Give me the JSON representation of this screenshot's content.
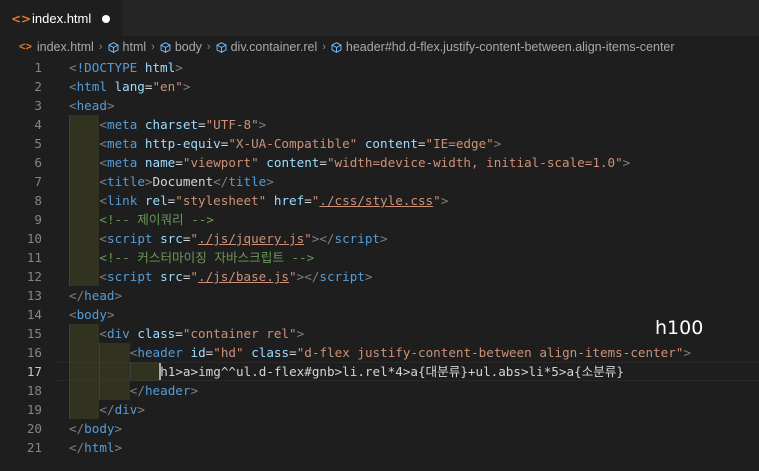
{
  "tab": {
    "icon": "html-code-icon",
    "label": "index.html",
    "dirty": true
  },
  "breadcrumb": [
    {
      "label": "index.html",
      "icon": "html-code-icon"
    },
    {
      "label": "html",
      "icon": "symbol-cube-icon"
    },
    {
      "label": "body",
      "icon": "symbol-cube-icon"
    },
    {
      "label": "div.container.rel",
      "icon": "symbol-cube-icon"
    },
    {
      "label": "header#hd.d-flex.justify-content-between.align-items-center",
      "icon": "symbol-cube-icon"
    }
  ],
  "current_line": 17,
  "overlay_text": "h100",
  "lines": [
    {
      "n": "1",
      "indent": 0,
      "tokens": [
        [
          "br",
          "<"
        ],
        [
          "tag",
          "!DOCTYPE"
        ],
        [
          "txt",
          " "
        ],
        [
          "attr",
          "html"
        ],
        [
          "br",
          ">"
        ]
      ]
    },
    {
      "n": "2",
      "indent": 0,
      "tokens": [
        [
          "br",
          "<"
        ],
        [
          "tag",
          "html"
        ],
        [
          "txt",
          " "
        ],
        [
          "attr",
          "lang"
        ],
        [
          "txt",
          "="
        ],
        [
          "str",
          "\"en\""
        ],
        [
          "br",
          ">"
        ]
      ]
    },
    {
      "n": "3",
      "indent": 0,
      "tokens": [
        [
          "br",
          "<"
        ],
        [
          "tag",
          "head"
        ],
        [
          "br",
          ">"
        ]
      ]
    },
    {
      "n": "4",
      "indent": 1,
      "tokens": [
        [
          "br",
          "<"
        ],
        [
          "tag",
          "meta"
        ],
        [
          "txt",
          " "
        ],
        [
          "attr",
          "charset"
        ],
        [
          "txt",
          "="
        ],
        [
          "str",
          "\"UTF-8\""
        ],
        [
          "br",
          ">"
        ]
      ]
    },
    {
      "n": "5",
      "indent": 1,
      "tokens": [
        [
          "br",
          "<"
        ],
        [
          "tag",
          "meta"
        ],
        [
          "txt",
          " "
        ],
        [
          "attr",
          "http-equiv"
        ],
        [
          "txt",
          "="
        ],
        [
          "str",
          "\"X-UA-Compatible\""
        ],
        [
          "txt",
          " "
        ],
        [
          "attr",
          "content"
        ],
        [
          "txt",
          "="
        ],
        [
          "str",
          "\"IE=edge\""
        ],
        [
          "br",
          ">"
        ]
      ]
    },
    {
      "n": "6",
      "indent": 1,
      "tokens": [
        [
          "br",
          "<"
        ],
        [
          "tag",
          "meta"
        ],
        [
          "txt",
          " "
        ],
        [
          "attr",
          "name"
        ],
        [
          "txt",
          "="
        ],
        [
          "str",
          "\"viewport\""
        ],
        [
          "txt",
          " "
        ],
        [
          "attr",
          "content"
        ],
        [
          "txt",
          "="
        ],
        [
          "str",
          "\"width=device-width, initial-scale=1.0\""
        ],
        [
          "br",
          ">"
        ]
      ]
    },
    {
      "n": "7",
      "indent": 1,
      "tokens": [
        [
          "br",
          "<"
        ],
        [
          "tag",
          "title"
        ],
        [
          "br",
          ">"
        ],
        [
          "txt",
          "Document"
        ],
        [
          "br",
          "</"
        ],
        [
          "tag",
          "title"
        ],
        [
          "br",
          ">"
        ]
      ]
    },
    {
      "n": "8",
      "indent": 1,
      "tokens": [
        [
          "br",
          "<"
        ],
        [
          "tag",
          "link"
        ],
        [
          "txt",
          " "
        ],
        [
          "attr",
          "rel"
        ],
        [
          "txt",
          "="
        ],
        [
          "str",
          "\"stylesheet\""
        ],
        [
          "txt",
          " "
        ],
        [
          "attr",
          "href"
        ],
        [
          "txt",
          "="
        ],
        [
          "str",
          "\""
        ],
        [
          "link",
          "./css/style.css"
        ],
        [
          "str",
          "\""
        ],
        [
          "br",
          ">"
        ]
      ]
    },
    {
      "n": "9",
      "indent": 1,
      "tokens": [
        [
          "cmt",
          "<!-- 제이쿼리 -->"
        ]
      ]
    },
    {
      "n": "10",
      "indent": 1,
      "tokens": [
        [
          "br",
          "<"
        ],
        [
          "tag",
          "script"
        ],
        [
          "txt",
          " "
        ],
        [
          "attr",
          "src"
        ],
        [
          "txt",
          "="
        ],
        [
          "str",
          "\""
        ],
        [
          "link",
          "./js/jquery.js"
        ],
        [
          "str",
          "\""
        ],
        [
          "br",
          "></"
        ],
        [
          "tag",
          "script"
        ],
        [
          "br",
          ">"
        ]
      ]
    },
    {
      "n": "11",
      "indent": 1,
      "tokens": [
        [
          "cmt",
          "<!-- 커스터마이징 자바스크립트 -->"
        ]
      ]
    },
    {
      "n": "12",
      "indent": 1,
      "tokens": [
        [
          "br",
          "<"
        ],
        [
          "tag",
          "script"
        ],
        [
          "txt",
          " "
        ],
        [
          "attr",
          "src"
        ],
        [
          "txt",
          "="
        ],
        [
          "str",
          "\""
        ],
        [
          "link",
          "./js/base.js"
        ],
        [
          "str",
          "\""
        ],
        [
          "br",
          "></"
        ],
        [
          "tag",
          "script"
        ],
        [
          "br",
          ">"
        ]
      ]
    },
    {
      "n": "13",
      "indent": 0,
      "tokens": [
        [
          "br",
          "</"
        ],
        [
          "tag",
          "head"
        ],
        [
          "br",
          ">"
        ]
      ]
    },
    {
      "n": "14",
      "indent": 0,
      "tokens": [
        [
          "br",
          "<"
        ],
        [
          "tag",
          "body"
        ],
        [
          "br",
          ">"
        ]
      ]
    },
    {
      "n": "15",
      "indent": 1,
      "tokens": [
        [
          "br",
          "<"
        ],
        [
          "tag",
          "div"
        ],
        [
          "txt",
          " "
        ],
        [
          "attr",
          "class"
        ],
        [
          "txt",
          "="
        ],
        [
          "str",
          "\"container rel\""
        ],
        [
          "br",
          ">"
        ]
      ]
    },
    {
      "n": "16",
      "indent": 2,
      "tokens": [
        [
          "br",
          "<"
        ],
        [
          "tag",
          "header"
        ],
        [
          "txt",
          " "
        ],
        [
          "attr",
          "id"
        ],
        [
          "txt",
          "="
        ],
        [
          "str",
          "\"hd\""
        ],
        [
          "txt",
          " "
        ],
        [
          "attr",
          "class"
        ],
        [
          "txt",
          "="
        ],
        [
          "str",
          "\"d-flex justify-content-between align-items-center\""
        ],
        [
          "br",
          ">"
        ]
      ]
    },
    {
      "n": "17",
      "indent": 3,
      "tokens": [
        [
          "txt",
          "h1>a>img^^ul.d-flex#gnb>li.rel*4>a{대분류}+ul.abs>li*5>a{소분류}"
        ]
      ]
    },
    {
      "n": "18",
      "indent": 2,
      "tokens": [
        [
          "br",
          "</"
        ],
        [
          "tag",
          "header"
        ],
        [
          "br",
          ">"
        ]
      ]
    },
    {
      "n": "19",
      "indent": 1,
      "tokens": [
        [
          "br",
          "</"
        ],
        [
          "tag",
          "div"
        ],
        [
          "br",
          ">"
        ]
      ]
    },
    {
      "n": "20",
      "indent": 0,
      "tokens": [
        [
          "br",
          "</"
        ],
        [
          "tag",
          "body"
        ],
        [
          "br",
          ">"
        ]
      ]
    },
    {
      "n": "21",
      "indent": 0,
      "tokens": [
        [
          "br",
          "</"
        ],
        [
          "tag",
          "html"
        ],
        [
          "br",
          ">"
        ]
      ]
    }
  ]
}
